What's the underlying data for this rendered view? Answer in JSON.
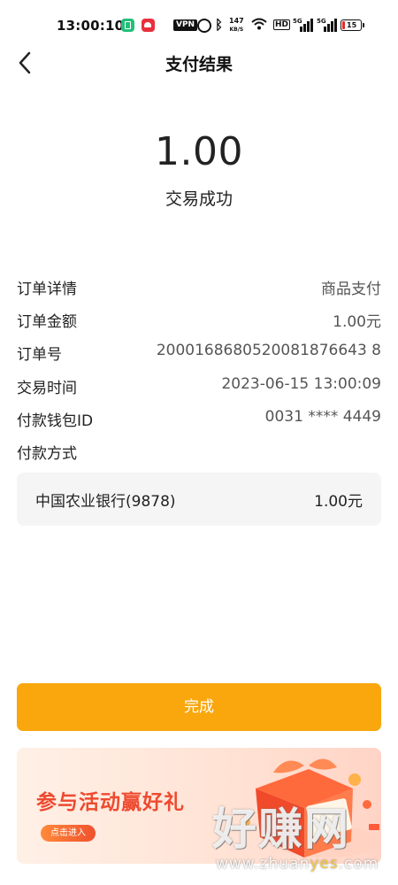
{
  "status_bar": {
    "time": "13:00:10",
    "vpn": "VPN",
    "net_speed_value": "147",
    "net_speed_unit": "KB/S",
    "hd": "HD",
    "signal1": "5G",
    "signal2": "5G",
    "battery": "15"
  },
  "header": {
    "title": "支付结果"
  },
  "result": {
    "amount": "1.00",
    "status": "交易成功"
  },
  "details": [
    {
      "label": "订单详情",
      "value": "商品支付"
    },
    {
      "label": "订单金额",
      "value": "1.00元"
    },
    {
      "label": "订单号",
      "value": "2000168680520081876643 8"
    },
    {
      "label": "交易时间",
      "value": "2023-06-15 13:00:09"
    },
    {
      "label": "付款钱包ID",
      "value": "0031 **** 4449"
    },
    {
      "label": "付款方式",
      "value": ""
    }
  ],
  "payment_method": {
    "bank": "中国农业银行(9878)",
    "amount": "1.00元"
  },
  "done_button": "完成",
  "banner": {
    "title": "参与活动赢好礼",
    "button": "点击进入"
  },
  "watermark": {
    "main": "好赚网",
    "url_prefix": "www.zhuan",
    "url_highlight": "yes",
    "url_suffix": ".com"
  }
}
